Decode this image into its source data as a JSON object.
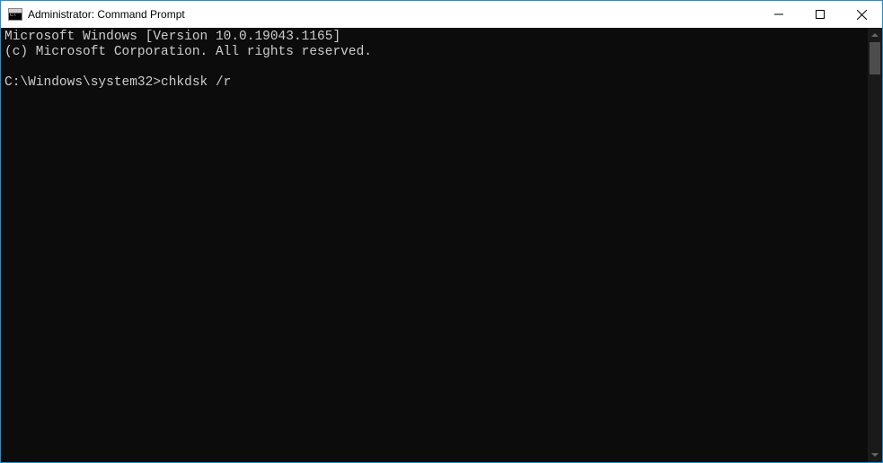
{
  "window": {
    "title": "Administrator: Command Prompt"
  },
  "terminal": {
    "line1": "Microsoft Windows [Version 10.0.19043.1165]",
    "line2": "(c) Microsoft Corporation. All rights reserved.",
    "blank": "",
    "prompt": "C:\\Windows\\system32>",
    "command": "chkdsk /r"
  }
}
